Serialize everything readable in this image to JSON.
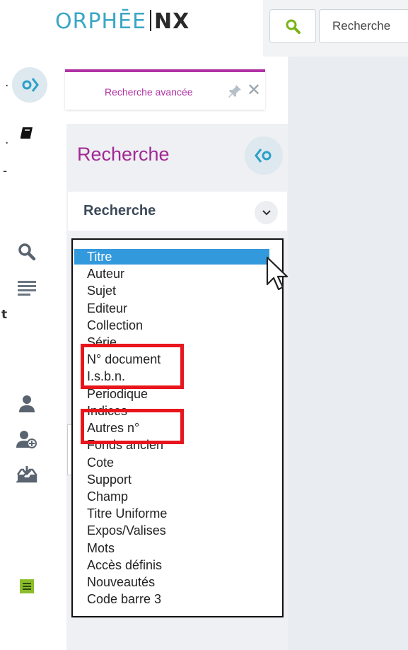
{
  "app": {
    "brand_main": "ORPHĒE",
    "brand_suffix": "NX"
  },
  "topbar": {
    "search_icon": "search-icon",
    "search_placeholder": "Recherche"
  },
  "left_edge_fragments": [
    ".",
    ".",
    "-",
    "t"
  ],
  "rail": {
    "items": [
      {
        "name": "expand-sidebar-icon"
      },
      {
        "name": "book-icon"
      },
      {
        "name": "search-icon"
      },
      {
        "name": "list-icon"
      },
      {
        "name": "user-icon"
      },
      {
        "name": "add-user-icon"
      },
      {
        "name": "inbox-download-icon"
      },
      {
        "name": "document-icon"
      }
    ]
  },
  "tab": {
    "label": "Recherche avancée",
    "pin_icon": "pin-icon",
    "close_icon": "close-icon",
    "close_glyph": "✕"
  },
  "panel": {
    "title": "Recherche",
    "collapse_icon": "collapse-panel-icon",
    "field_label": "Recherche",
    "field_chevron_icon": "chevron-down-icon"
  },
  "dropdown": {
    "selected": "Titre",
    "options": [
      "Titre",
      "Auteur",
      "Sujet",
      "Editeur",
      "Collection",
      "Série",
      "N° document",
      "I.s.b.n.",
      "Periodique",
      "Indices",
      "Autres n°",
      "Fonds ancien",
      "Cote",
      "Support",
      "Champ",
      "Titre Uniforme",
      "Expos/Valises",
      "Mots",
      "Accès définis",
      "Nouveautés",
      "Code barre 3"
    ]
  },
  "colors": {
    "brand_blue": "#3aa7c4",
    "accent_magenta": "#a22894",
    "selection_blue": "#3399dd",
    "highlight_red": "#e8161c"
  }
}
